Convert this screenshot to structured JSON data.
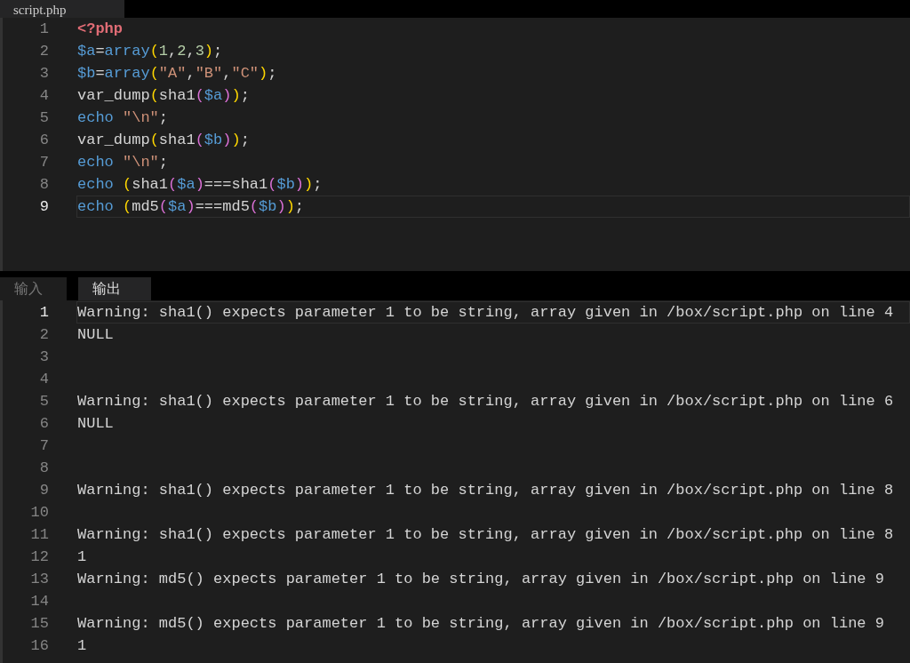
{
  "file_tab": {
    "label": "script.php",
    "selected": true
  },
  "editor": {
    "lines": [
      {
        "number": "1",
        "active": false,
        "tokens": [
          {
            "text": "<?php",
            "kind": "tag"
          }
        ]
      },
      {
        "number": "2",
        "active": false,
        "tokens": [
          {
            "text": "$a",
            "kind": "var"
          },
          {
            "text": "=",
            "kind": "plain"
          },
          {
            "text": "array",
            "kind": "func"
          },
          {
            "text": "(",
            "kind": "paren1"
          },
          {
            "text": "1",
            "kind": "num"
          },
          {
            "text": ",",
            "kind": "plain"
          },
          {
            "text": "2",
            "kind": "num"
          },
          {
            "text": ",",
            "kind": "plain"
          },
          {
            "text": "3",
            "kind": "num"
          },
          {
            "text": ")",
            "kind": "paren1"
          },
          {
            "text": ";",
            "kind": "plain"
          }
        ]
      },
      {
        "number": "3",
        "active": false,
        "tokens": [
          {
            "text": "$b",
            "kind": "var"
          },
          {
            "text": "=",
            "kind": "plain"
          },
          {
            "text": "array",
            "kind": "func"
          },
          {
            "text": "(",
            "kind": "paren1"
          },
          {
            "text": "\"A\"",
            "kind": "str"
          },
          {
            "text": ",",
            "kind": "plain"
          },
          {
            "text": "\"B\"",
            "kind": "str"
          },
          {
            "text": ",",
            "kind": "plain"
          },
          {
            "text": "\"C\"",
            "kind": "str"
          },
          {
            "text": ")",
            "kind": "paren1"
          },
          {
            "text": ";",
            "kind": "plain"
          }
        ]
      },
      {
        "number": "4",
        "active": false,
        "tokens": [
          {
            "text": "var_dump",
            "kind": "plain"
          },
          {
            "text": "(",
            "kind": "paren1"
          },
          {
            "text": "sha1",
            "kind": "plain"
          },
          {
            "text": "(",
            "kind": "paren2"
          },
          {
            "text": "$a",
            "kind": "var"
          },
          {
            "text": ")",
            "kind": "paren2"
          },
          {
            "text": ")",
            "kind": "paren1"
          },
          {
            "text": ";",
            "kind": "plain"
          }
        ]
      },
      {
        "number": "5",
        "active": false,
        "tokens": [
          {
            "text": "echo",
            "kind": "keyword"
          },
          {
            "text": "\"\\n\"",
            "kind": "str"
          },
          {
            "text": ";",
            "kind": "plain"
          }
        ]
      },
      {
        "number": "6",
        "active": false,
        "tokens": [
          {
            "text": "var_dump",
            "kind": "plain"
          },
          {
            "text": "(",
            "kind": "paren1"
          },
          {
            "text": "sha1",
            "kind": "plain"
          },
          {
            "text": "(",
            "kind": "paren2"
          },
          {
            "text": "$b",
            "kind": "var"
          },
          {
            "text": ")",
            "kind": "paren2"
          },
          {
            "text": ")",
            "kind": "paren1"
          },
          {
            "text": ";",
            "kind": "plain"
          }
        ]
      },
      {
        "number": "7",
        "active": false,
        "tokens": [
          {
            "text": "echo",
            "kind": "keyword"
          },
          {
            "text": "\"\\n\"",
            "kind": "str"
          },
          {
            "text": ";",
            "kind": "plain"
          }
        ]
      },
      {
        "number": "8",
        "active": false,
        "tokens": [
          {
            "text": "echo",
            "kind": "keyword"
          },
          {
            "text": "(",
            "kind": "paren1"
          },
          {
            "text": "sha1",
            "kind": "plain"
          },
          {
            "text": "(",
            "kind": "paren2"
          },
          {
            "text": "$a",
            "kind": "var"
          },
          {
            "text": ")",
            "kind": "paren2"
          },
          {
            "text": "===",
            "kind": "plain"
          },
          {
            "text": "sha1",
            "kind": "plain"
          },
          {
            "text": "(",
            "kind": "paren2"
          },
          {
            "text": "$b",
            "kind": "var"
          },
          {
            "text": ")",
            "kind": "paren2"
          },
          {
            "text": ")",
            "kind": "paren1"
          },
          {
            "text": ";",
            "kind": "plain"
          }
        ]
      },
      {
        "number": "9",
        "active": true,
        "tokens": [
          {
            "text": "echo",
            "kind": "keyword"
          },
          {
            "text": "(",
            "kind": "paren1"
          },
          {
            "text": "md5",
            "kind": "plain"
          },
          {
            "text": "(",
            "kind": "paren2"
          },
          {
            "text": "$a",
            "kind": "var"
          },
          {
            "text": ")",
            "kind": "paren2"
          },
          {
            "text": "===",
            "kind": "plain"
          },
          {
            "text": "md5",
            "kind": "plain"
          },
          {
            "text": "(",
            "kind": "paren2"
          },
          {
            "text": "$b",
            "kind": "var"
          },
          {
            "text": ")",
            "kind": "paren2"
          },
          {
            "text": ")",
            "kind": "paren1"
          },
          {
            "text": ";",
            "kind": "plain"
          }
        ]
      }
    ]
  },
  "panel_tabs": [
    {
      "label": "输入",
      "selected": false
    },
    {
      "label": "输出",
      "selected": true
    }
  ],
  "output": {
    "lines": [
      {
        "number": "1",
        "active": true,
        "text": "Warning: sha1() expects parameter 1 to be string, array given in /box/script.php on line 4"
      },
      {
        "number": "2",
        "active": false,
        "text": "NULL"
      },
      {
        "number": "3",
        "active": false
      },
      {
        "number": "4",
        "active": false
      },
      {
        "number": "5",
        "active": false,
        "text": "Warning: sha1() expects parameter 1 to be string, array given in /box/script.php on line 6"
      },
      {
        "number": "6",
        "active": false,
        "text": "NULL"
      },
      {
        "number": "7",
        "active": false
      },
      {
        "number": "8",
        "active": false
      },
      {
        "number": "9",
        "active": false,
        "text": "Warning: sha1() expects parameter 1 to be string, array given in /box/script.php on line 8"
      },
      {
        "number": "10",
        "active": false
      },
      {
        "number": "11",
        "active": false,
        "text": "Warning: sha1() expects parameter 1 to be string, array given in /box/script.php on line 8"
      },
      {
        "number": "12",
        "active": false,
        "text": "1"
      },
      {
        "number": "13",
        "active": false,
        "text": "Warning: md5() expects parameter 1 to be string, array given in /box/script.php on line 9"
      },
      {
        "number": "14",
        "active": false
      },
      {
        "number": "15",
        "active": false,
        "text": "Warning: md5() expects parameter 1 to be string, array given in /box/script.php on line 9"
      },
      {
        "number": "16",
        "active": false,
        "text": "1"
      }
    ]
  }
}
